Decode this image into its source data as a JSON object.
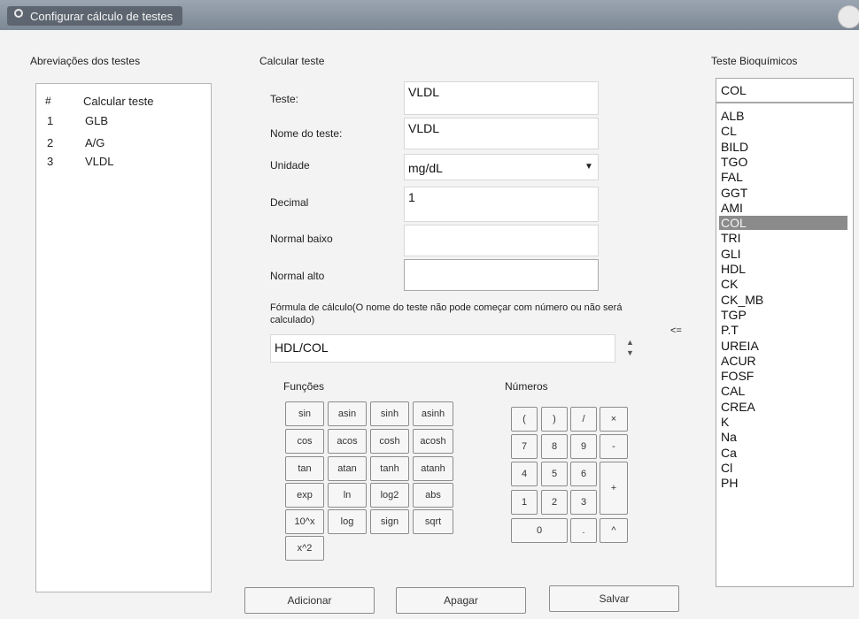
{
  "window": {
    "title": "Configurar cálculo de testes",
    "icon": "bulb-icon"
  },
  "left_panel": {
    "title": "Abreviações dos testes",
    "columns": [
      "#",
      "Calcular teste"
    ],
    "rows": [
      {
        "num": "1",
        "name": "GLB"
      },
      {
        "num": "2",
        "name": "A/G"
      },
      {
        "num": "3",
        "name": "VLDL"
      }
    ]
  },
  "center": {
    "title": "Calcular teste",
    "fields": {
      "teste": {
        "label": "Teste:",
        "value": "VLDL"
      },
      "nome": {
        "label": "Nome do teste:",
        "value": "VLDL"
      },
      "unidade": {
        "label": "Unidade",
        "value": "mg/dL"
      },
      "decimal": {
        "label": "Decimal",
        "value": "1"
      },
      "normal_baixo": {
        "label": "Normal baixo",
        "value": ""
      },
      "normal_alto": {
        "label": "Normal alto",
        "value": ""
      }
    },
    "formula": {
      "label": "Fórmula de cálculo(O nome do teste não pode começar com número ou não será calculado)",
      "value": "HDL/COL",
      "insert_label": "<="
    },
    "functions_title": "Funções",
    "functions": [
      "sin",
      "asin",
      "sinh",
      "asinh",
      "cos",
      "acos",
      "cosh",
      "acosh",
      "tan",
      "atan",
      "tanh",
      "atanh",
      "exp",
      "ln",
      "log2",
      "abs",
      "10^x",
      "log",
      "sign",
      "sqrt",
      "x^2"
    ],
    "numbers_title": "Números",
    "number_keys": {
      "open_paren": "(",
      "close_paren": ")",
      "divide": "/",
      "multiply": "×",
      "n7": "7",
      "n8": "8",
      "n9": "9",
      "minus": "-",
      "n4": "4",
      "n5": "5",
      "n6": "6",
      "plus": "+",
      "n1": "1",
      "n2": "2",
      "n3": "3",
      "n0": "0",
      "dot": ".",
      "power": "^"
    }
  },
  "right_panel": {
    "title": "Teste Bioquímicos",
    "selected_value": "COL",
    "items": [
      "ALB",
      "CL",
      "BILD",
      "TGO",
      "FAL",
      "GGT",
      "AMI",
      "COL",
      "TRI",
      "GLI",
      "HDL",
      "CK",
      "CK_MB",
      "TGP",
      "P.T",
      "UREIA",
      "ACUR",
      "FOSF",
      "CAL",
      "CREA",
      "K",
      "Na",
      "Ca",
      "Cl",
      "PH"
    ],
    "selected_index": 7
  },
  "buttons": {
    "add": "Adicionar",
    "delete": "Apagar",
    "save": "Salvar"
  }
}
